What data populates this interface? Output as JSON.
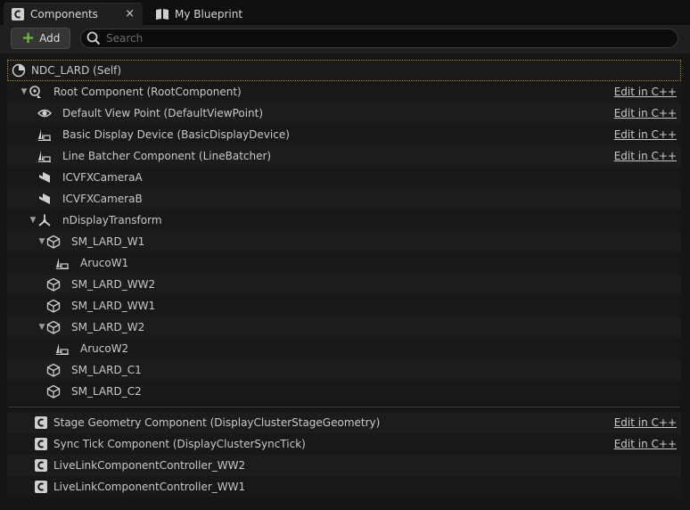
{
  "tabs": [
    {
      "label": "Components",
      "icon": "class-icon",
      "active": true,
      "close": "×"
    },
    {
      "label": "My Blueprint",
      "icon": "book-icon",
      "active": false
    }
  ],
  "toolbar": {
    "add_label": "Add",
    "add_symbol": "+",
    "search_placeholder": "Search"
  },
  "tree": {
    "edit_label": "Edit in C++",
    "rows": [
      {
        "label": "NDC_LARD (Self)",
        "icon": "actor-self-icon",
        "expand": "",
        "edit": false
      },
      {
        "label": "Root Component (RootComponent)",
        "icon": "scene-root-icon",
        "expand": "▼",
        "edit": true
      },
      {
        "label": "Default View Point (DefaultViewPoint)",
        "icon": "eye-icon",
        "expand": "",
        "edit": true
      },
      {
        "label": "Basic Display Device (BasicDisplayDevice)",
        "icon": "display-device-icon",
        "expand": "",
        "edit": true
      },
      {
        "label": "Line Batcher Component (LineBatcher)",
        "icon": "display-device-icon",
        "expand": "",
        "edit": true
      },
      {
        "label": "ICVFXCameraA",
        "icon": "camera-icon",
        "expand": "",
        "edit": false
      },
      {
        "label": "ICVFXCameraB",
        "icon": "camera-icon",
        "expand": "",
        "edit": false
      },
      {
        "label": "nDisplayTransform",
        "icon": "transform-icon",
        "expand": "▼",
        "edit": false
      },
      {
        "label": "SM_LARD_W1",
        "icon": "static-mesh-icon",
        "expand": "▼",
        "edit": false
      },
      {
        "label": "ArucoW1",
        "icon": "display-device-icon",
        "expand": "",
        "edit": false
      },
      {
        "label": "SM_LARD_WW2",
        "icon": "static-mesh-icon",
        "expand": "",
        "edit": false
      },
      {
        "label": "SM_LARD_WW1",
        "icon": "static-mesh-icon",
        "expand": "",
        "edit": false
      },
      {
        "label": "SM_LARD_W2",
        "icon": "static-mesh-icon",
        "expand": "▼",
        "edit": false
      },
      {
        "label": "ArucoW2",
        "icon": "display-device-icon",
        "expand": "",
        "edit": false
      },
      {
        "label": "SM_LARD_C1",
        "icon": "static-mesh-icon",
        "expand": "",
        "edit": false
      },
      {
        "label": "SM_LARD_C2",
        "icon": "static-mesh-icon",
        "expand": "",
        "edit": false
      }
    ],
    "rows2": [
      {
        "label": "Stage Geometry Component (DisplayClusterStageGeometry)",
        "icon": "class-icon",
        "edit": true
      },
      {
        "label": "Sync Tick Component (DisplayClusterSyncTick)",
        "icon": "class-icon",
        "edit": true
      },
      {
        "label": "LiveLinkComponentController_WW2",
        "icon": "class-icon",
        "edit": false
      },
      {
        "label": "LiveLinkComponentController_WW1",
        "icon": "class-icon",
        "edit": false
      }
    ]
  },
  "colors": {
    "accent_green": "#6fbf3f",
    "selection_outline": "#b07a1e",
    "background": "#151515"
  }
}
